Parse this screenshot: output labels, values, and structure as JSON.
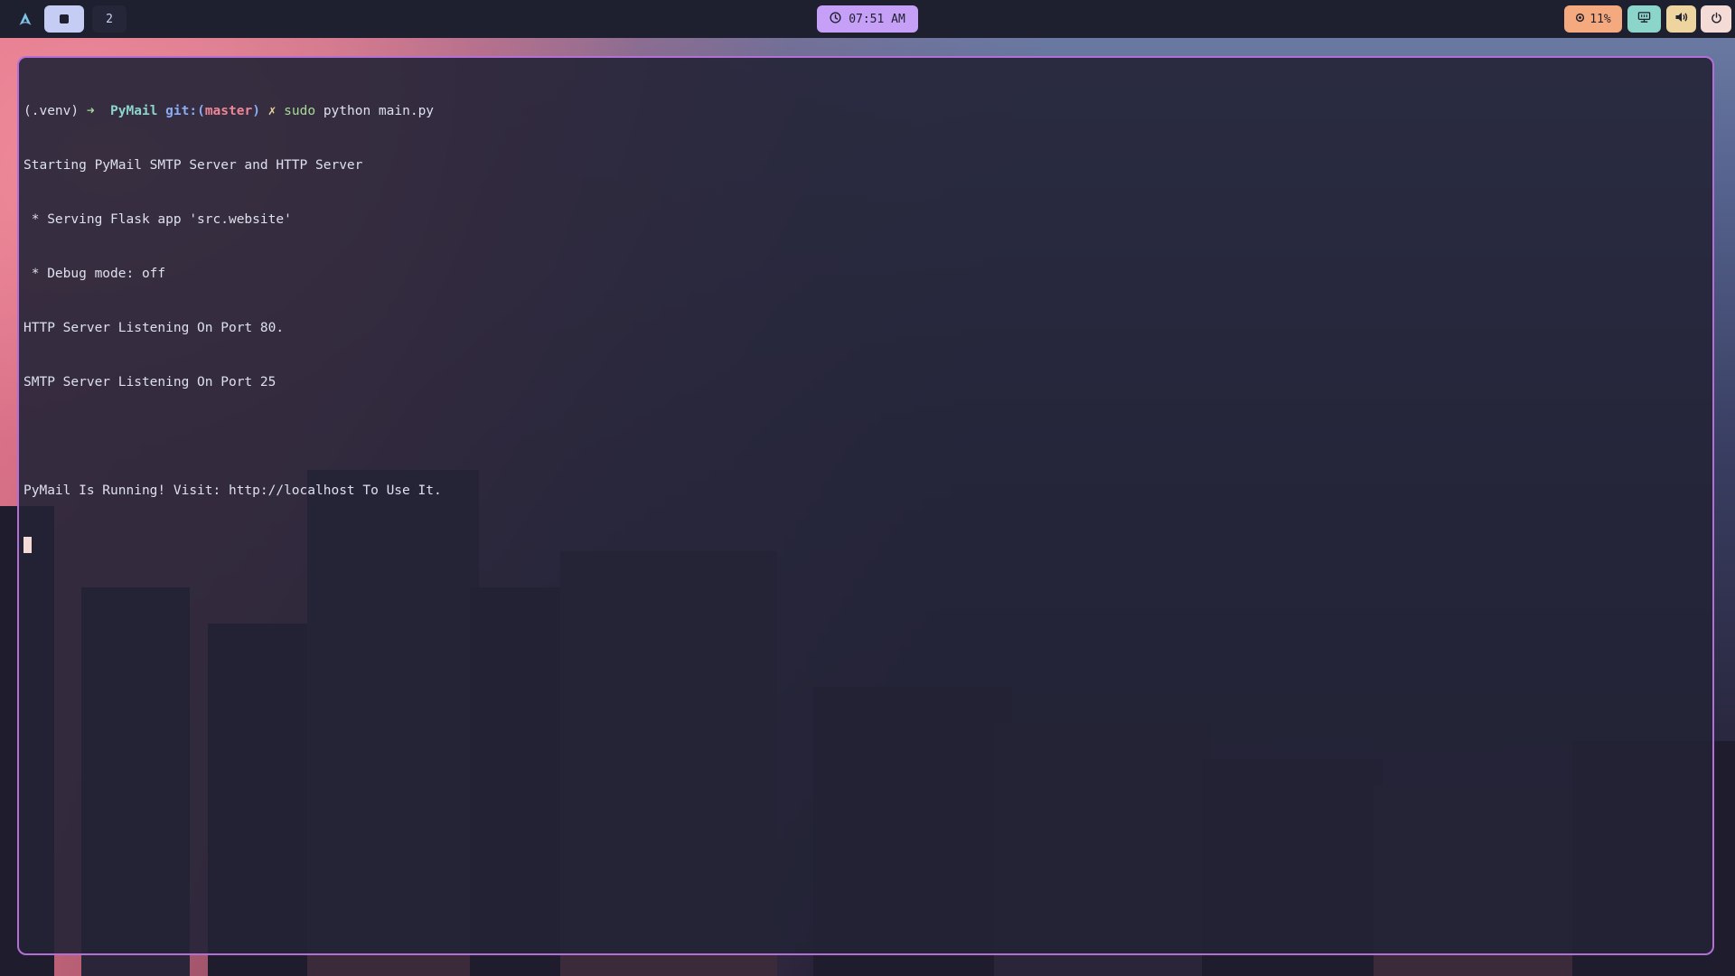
{
  "topbar": {
    "launcher_icon": "arch-logo-icon",
    "workspaces": [
      {
        "label": "",
        "active": true
      },
      {
        "label": "2",
        "active": false
      }
    ],
    "clock": {
      "icon": "clock-icon",
      "time": "07:51 AM"
    },
    "tray": {
      "cpu": {
        "icon": "cpu-icon",
        "value": "11%"
      },
      "network_icon": "ethernet-icon",
      "volume_icon": "volume-icon",
      "power_icon": "power-icon"
    }
  },
  "terminal": {
    "prompt": {
      "venv": "(.venv)",
      "arrow": "➜",
      "dir": "PyMail",
      "git_prefix": "git:(",
      "branch": "master",
      "git_suffix": ")",
      "dirty": "✗",
      "cmd_sudo": "sudo",
      "cmd_rest": "python main.py"
    },
    "output": [
      "Starting PyMail SMTP Server and HTTP Server",
      " * Serving Flask app 'src.website'",
      " * Debug mode: off",
      "HTTP Server Listening On Port 80.",
      "SMTP Server Listening On Port 25",
      "",
      "PyMail Is Running! Visit: http://localhost To Use It."
    ]
  },
  "colors": {
    "border": "#b36fd6",
    "clock_bg": "#c6a0f6",
    "cpu_bg": "#f5a97f",
    "net_bg": "#8bd5ca",
    "vol_bg": "#eed49f",
    "power_bg": "#f4dbd6"
  }
}
